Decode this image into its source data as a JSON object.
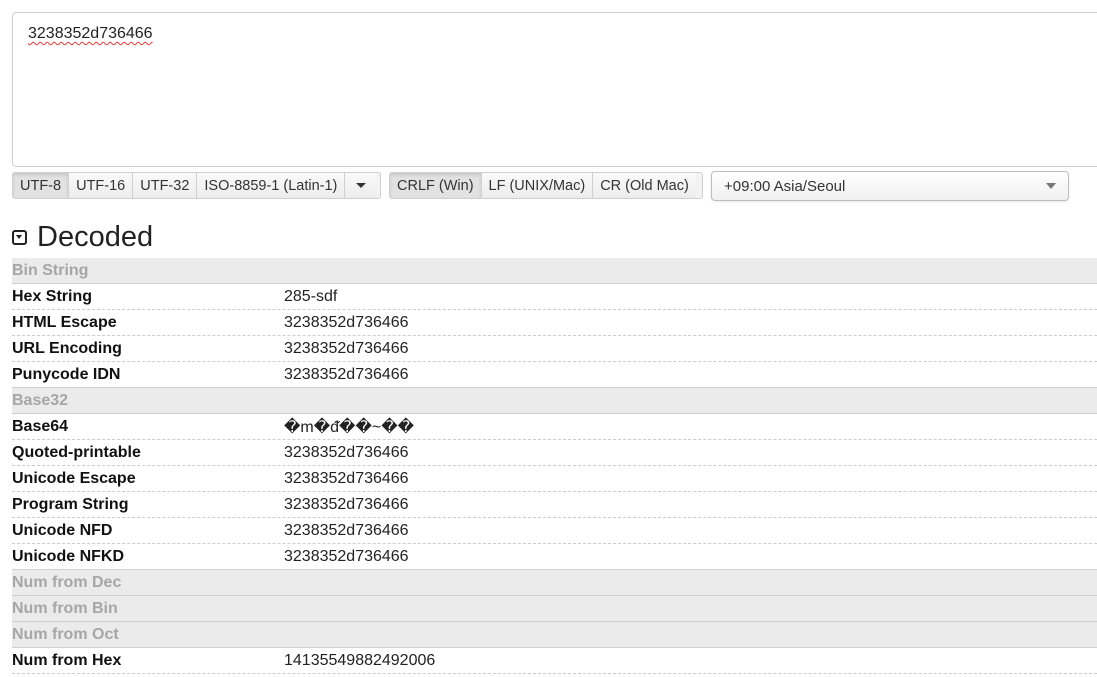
{
  "input": {
    "text": "3238352d736466"
  },
  "encoding_buttons": [
    "UTF-8",
    "UTF-16",
    "UTF-32",
    "ISO-8859-1 (Latin-1)"
  ],
  "newline_buttons": [
    "CRLF (Win)",
    "LF (UNIX/Mac)",
    "CR (Old Mac)"
  ],
  "timezone": {
    "selected": "+09:00 Asia/Seoul"
  },
  "section": {
    "title": "Decoded"
  },
  "rows": [
    {
      "label": "Bin String",
      "value": "",
      "disabled": true
    },
    {
      "label": "Hex String",
      "value": "285-sdf",
      "disabled": false
    },
    {
      "label": "HTML Escape",
      "value": "3238352d736466",
      "disabled": false
    },
    {
      "label": "URL Encoding",
      "value": "3238352d736466",
      "disabled": false
    },
    {
      "label": "Punycode IDN",
      "value": "3238352d736466",
      "disabled": false
    },
    {
      "label": "Base32",
      "value": "",
      "disabled": true
    },
    {
      "label": "Base64",
      "value": "�m�ᵭ��~��",
      "disabled": false
    },
    {
      "label": "Quoted-printable",
      "value": "3238352d736466",
      "disabled": false
    },
    {
      "label": "Unicode Escape",
      "value": "3238352d736466",
      "disabled": false
    },
    {
      "label": "Program String",
      "value": "3238352d736466",
      "disabled": false
    },
    {
      "label": "Unicode NFD",
      "value": "3238352d736466",
      "disabled": false
    },
    {
      "label": "Unicode NFKD",
      "value": "3238352d736466",
      "disabled": false
    },
    {
      "label": "Num from Dec",
      "value": "",
      "disabled": true
    },
    {
      "label": "Num from Bin",
      "value": "",
      "disabled": true
    },
    {
      "label": "Num from Oct",
      "value": "",
      "disabled": true
    },
    {
      "label": "Num from Hex",
      "value": "14135549882492006",
      "disabled": false
    }
  ]
}
